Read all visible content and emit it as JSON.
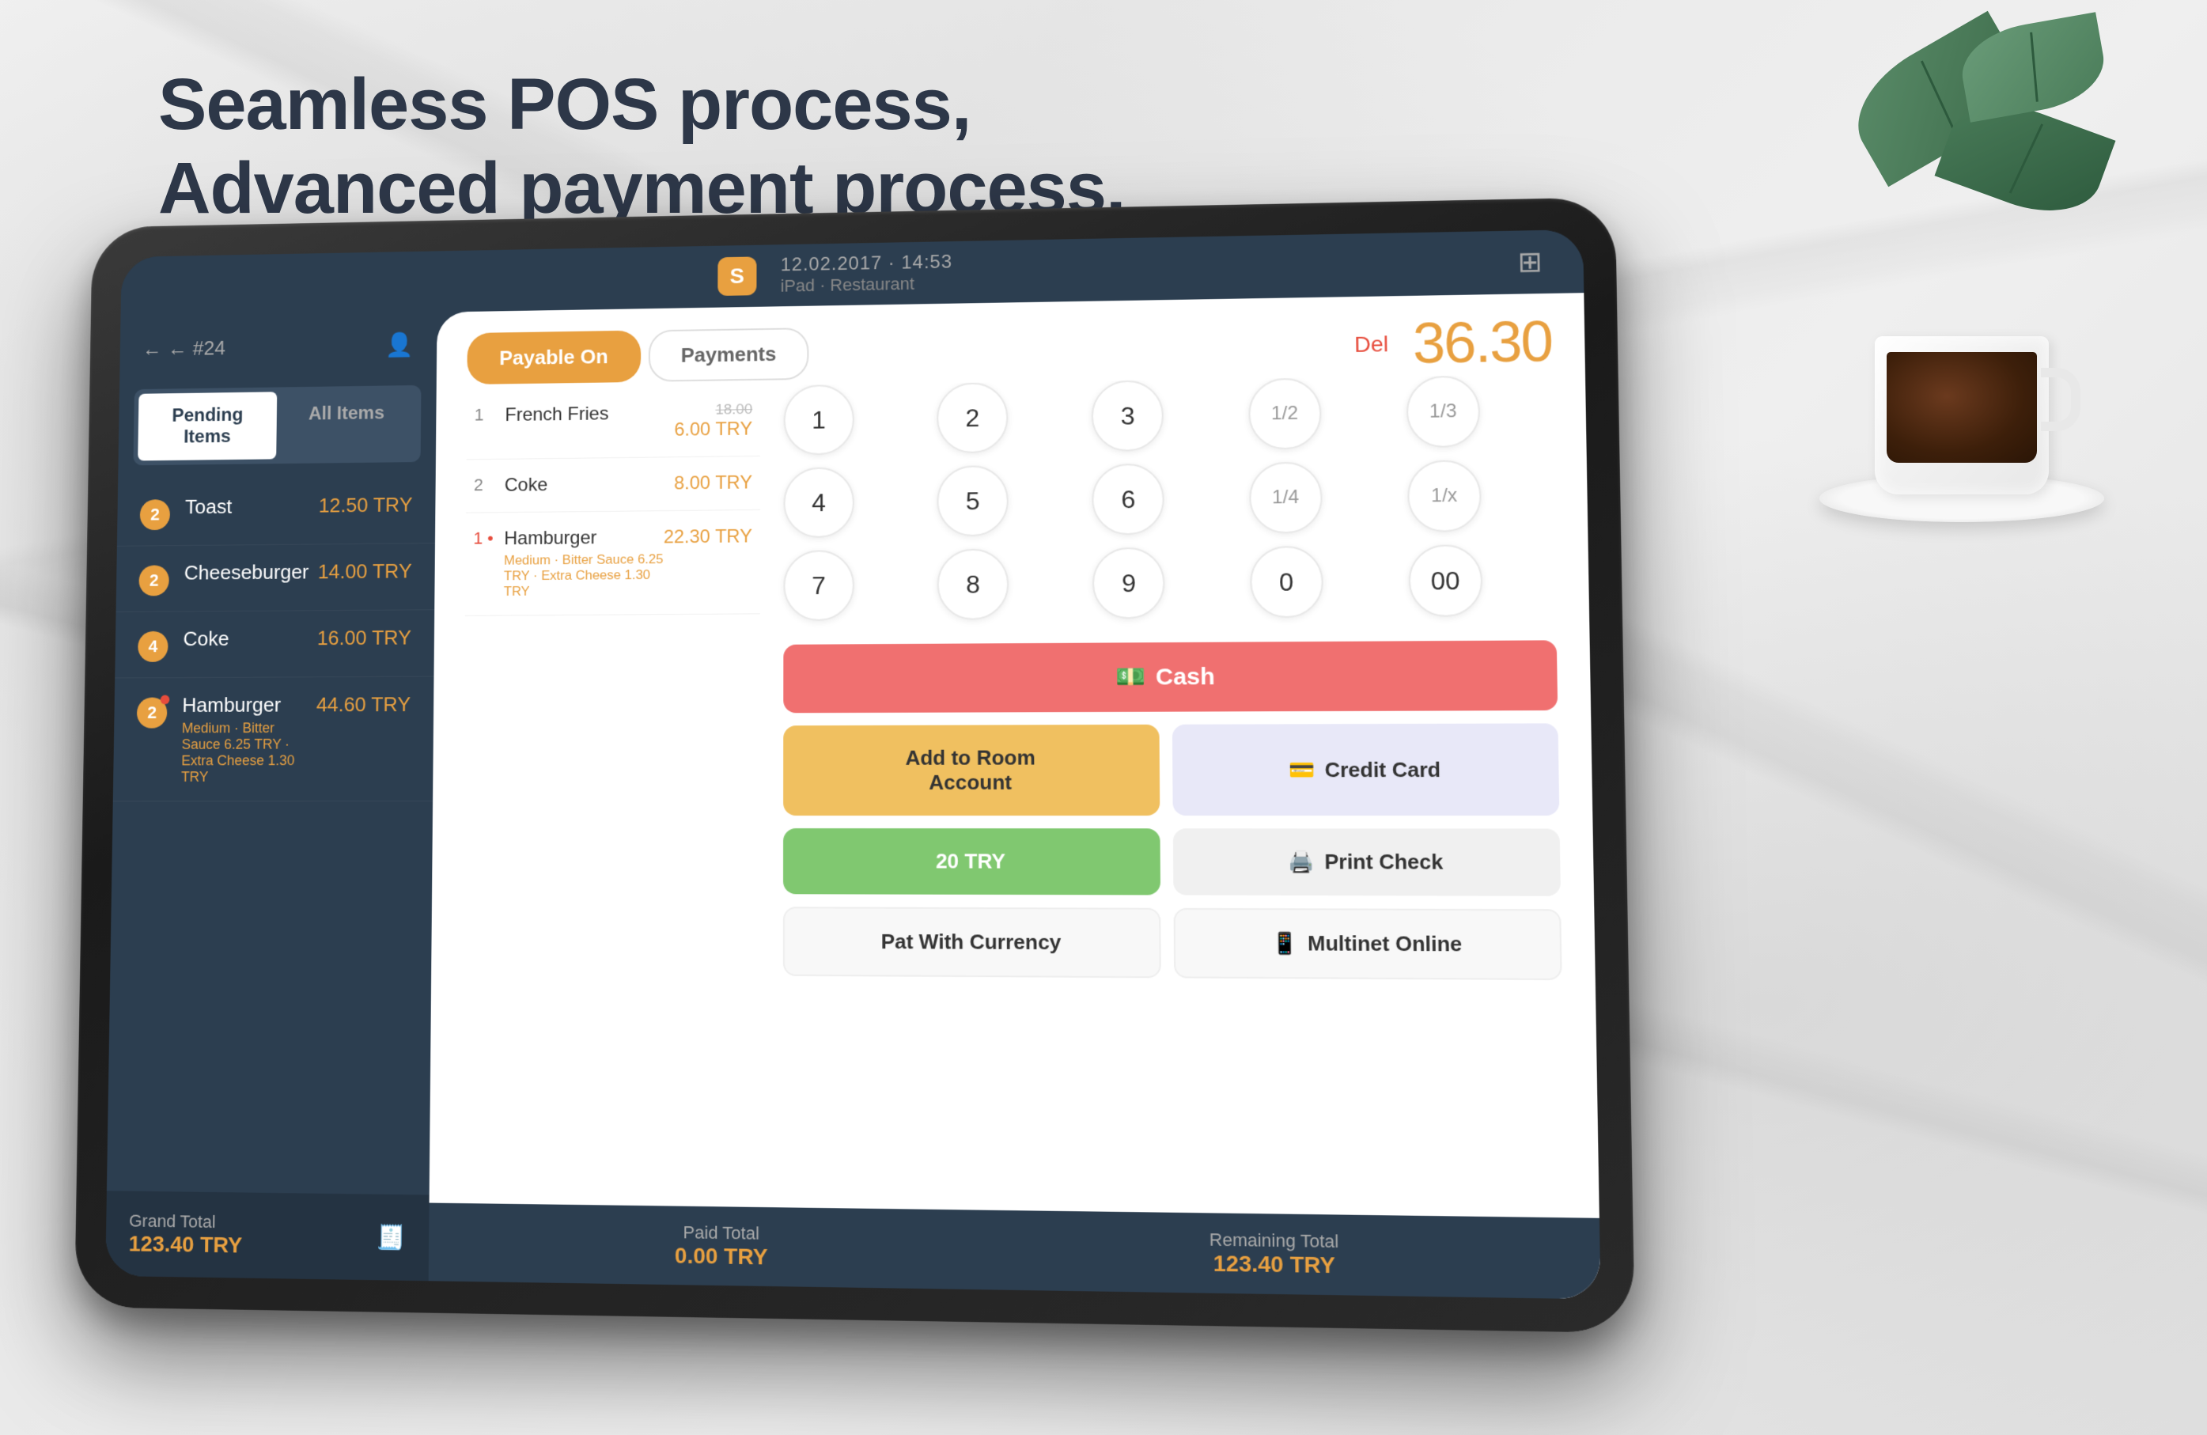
{
  "page": {
    "headline_line1": "Seamless POS process,",
    "headline_line2": "Advanced payment process."
  },
  "statusbar": {
    "datetime": "12.02.2017 · 14:53",
    "device": "iPad · Restaurant",
    "logo": "S"
  },
  "sidebar": {
    "back_label": "← #24",
    "pending_tab": "Pending Items",
    "all_tab": "All Items",
    "items": [
      {
        "qty": 2,
        "name": "Toast",
        "price": "12.50 TRY",
        "has_dot": false,
        "notes": ""
      },
      {
        "qty": 2,
        "name": "Cheeseburger",
        "price": "14.00 TRY",
        "has_dot": false,
        "notes": ""
      },
      {
        "qty": 4,
        "name": "Coke",
        "price": "16.00 TRY",
        "has_dot": false,
        "notes": ""
      },
      {
        "qty": 2,
        "name": "Hamburger",
        "price": "44.60 TRY",
        "has_dot": true,
        "notes": "Medium · Bitter Sauce 6.25 TRY · Extra Cheese 1.30 TRY"
      }
    ],
    "grand_total_label": "Grand Total",
    "grand_total": "123.40 TRY"
  },
  "payment": {
    "tab_payable": "Payable On",
    "tab_payments": "Payments",
    "del_label": "Del",
    "amount": "36.30",
    "items": [
      {
        "num": 1,
        "name": "French Fries",
        "original_price": "18.00",
        "price": "6.00 TRY",
        "notes": ""
      },
      {
        "num": 2,
        "name": "Coke",
        "price": "8.00 TRY",
        "notes": ""
      },
      {
        "num": 1,
        "name": "Hamburger",
        "price": "22.30 TRY",
        "notes": "Medium · Bitter Sauce 6.25 TRY · Extra Cheese 1.30 TRY"
      }
    ],
    "numpad": [
      "1",
      "2",
      "3",
      "1/2",
      "1/3",
      "4",
      "5",
      "6",
      "1/4",
      "1/x",
      "7",
      "8",
      "9",
      "0",
      "00"
    ],
    "methods": {
      "cash": "Cash",
      "room": "Add to Room\nAccount",
      "credit": "Credit Card",
      "try": "20 TRY",
      "print": "Print Check",
      "currency": "Pat With Currency",
      "multinet": "Multinet Online"
    },
    "paid_total_label": "Paid Total",
    "paid_total": "0.00 TRY",
    "remaining_label": "Remaining Total",
    "remaining": "123.40 TRY"
  }
}
